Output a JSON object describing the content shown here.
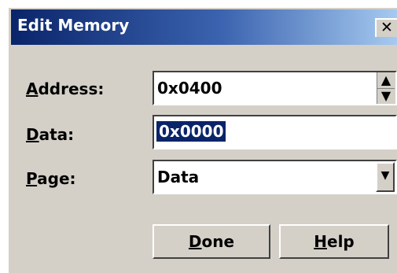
{
  "dialog": {
    "title": "Edit Memory",
    "close_glyph": "✕"
  },
  "form": {
    "address": {
      "label_mnemonic": "A",
      "label_rest": "ddress:",
      "value": "0x0400"
    },
    "data": {
      "label_mnemonic": "D",
      "label_rest": "ata:",
      "value": "0x0000"
    },
    "page": {
      "label_mnemonic": "P",
      "label_rest": "age:",
      "value": "Data"
    }
  },
  "buttons": {
    "done": {
      "mnemonic": "D",
      "rest": "one"
    },
    "help": {
      "mnemonic": "H",
      "rest": "elp"
    }
  },
  "icons": {
    "spin_up": "▲",
    "spin_down": "▼",
    "dropdown": "▼"
  }
}
